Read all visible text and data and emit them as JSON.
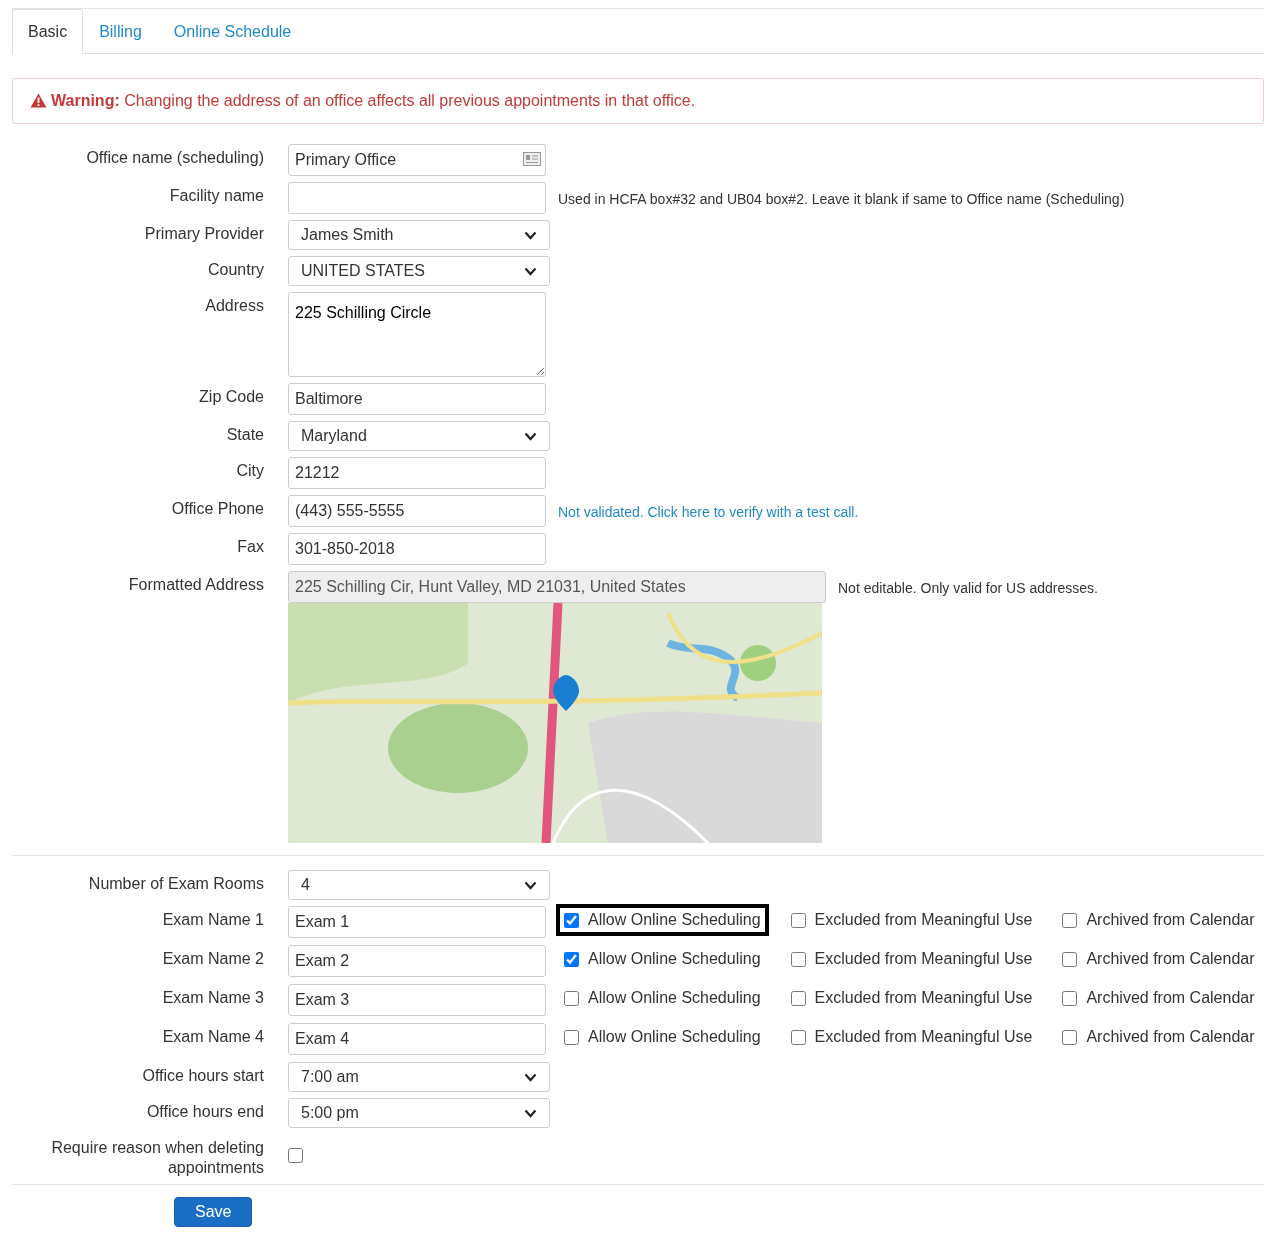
{
  "tabs": [
    {
      "label": "Basic",
      "selected": true
    },
    {
      "label": "Billing",
      "selected": false
    },
    {
      "label": "Online Schedule",
      "selected": false
    }
  ],
  "warning": {
    "label": "Warning:",
    "text": "Changing the address of an office affects all previous appointments in that office."
  },
  "office_fields": [
    {
      "kind": "text",
      "label": "Office name (scheduling)",
      "value": "Primary Office",
      "card_icon": true
    },
    {
      "kind": "text",
      "label": "Facility name",
      "note": "Used in HCFA box#32 and UB04 box#2. Leave it blank if same to Office name (Scheduling)"
    },
    {
      "kind": "select",
      "label": "Primary Provider",
      "value": "James Smith"
    },
    {
      "kind": "select",
      "label": "Country",
      "value": "UNITED STATES"
    },
    {
      "kind": "textarea",
      "label": "Address",
      "value": "225 Schilling Circle"
    },
    {
      "kind": "text",
      "label": "Zip Code",
      "value": "Baltimore"
    },
    {
      "kind": "select",
      "label": "State",
      "value": "Maryland"
    },
    {
      "kind": "text",
      "label": "City",
      "value": "21212"
    },
    {
      "kind": "text",
      "label": "Office Phone",
      "value": "(443) 555-5555",
      "link": "Not validated. Click here to verify with a test call."
    },
    {
      "kind": "text",
      "label": "Fax",
      "value": "301-850-2018"
    },
    {
      "kind": "readonly",
      "label": "Formatted Address",
      "value": "225 Schilling Cir, Hunt Valley, MD 21031, United States",
      "note": "Not editable. Only valid for US addresses."
    },
    {
      "kind": "picture"
    }
  ],
  "room_fields": [
    {
      "kind": "select",
      "label": "Number of Exam Rooms",
      "value": "4"
    },
    {
      "kind": "exam",
      "label": "Exam Name 1",
      "value": "Exam 1",
      "options": [
        {
          "label": "Allow Online Scheduling",
          "checked": true,
          "highlighted": true
        },
        {
          "label": "Excluded from Meaningful Use",
          "checked": false,
          "highlighted": false
        },
        {
          "label": "Archived from Calendar",
          "checked": false,
          "highlighted": false
        }
      ]
    },
    {
      "kind": "exam",
      "label": "Exam Name 2",
      "value": "Exam 2",
      "options": [
        {
          "label": "Allow Online Scheduling",
          "checked": true,
          "highlighted": false
        },
        {
          "label": "Excluded from Meaningful Use",
          "checked": false,
          "highlighted": false
        },
        {
          "label": "Archived from Calendar",
          "checked": false,
          "highlighted": false
        }
      ]
    },
    {
      "kind": "exam",
      "label": "Exam Name 3",
      "value": "Exam 3",
      "options": [
        {
          "label": "Allow Online Scheduling",
          "checked": false,
          "highlighted": false
        },
        {
          "label": "Excluded from Meaningful Use",
          "checked": false,
          "highlighted": false
        },
        {
          "label": "Archived from Calendar",
          "checked": false,
          "highlighted": false
        }
      ]
    },
    {
      "kind": "exam",
      "label": "Exam Name 4",
      "value": "Exam 4",
      "options": [
        {
          "label": "Allow Online Scheduling",
          "checked": false,
          "highlighted": false
        },
        {
          "label": "Excluded from Meaningful Use",
          "checked": false,
          "highlighted": false
        },
        {
          "label": "Archived from Calendar",
          "checked": false,
          "highlighted": false
        }
      ]
    },
    {
      "kind": "select",
      "label": "Office hours start",
      "value": "7:00 am"
    },
    {
      "kind": "select",
      "label": "Office hours end",
      "value": "5:00 pm"
    },
    {
      "kind": "checkbox",
      "label": "Require reason when deleting appointments",
      "checked": false
    }
  ],
  "save_button": "Save"
}
